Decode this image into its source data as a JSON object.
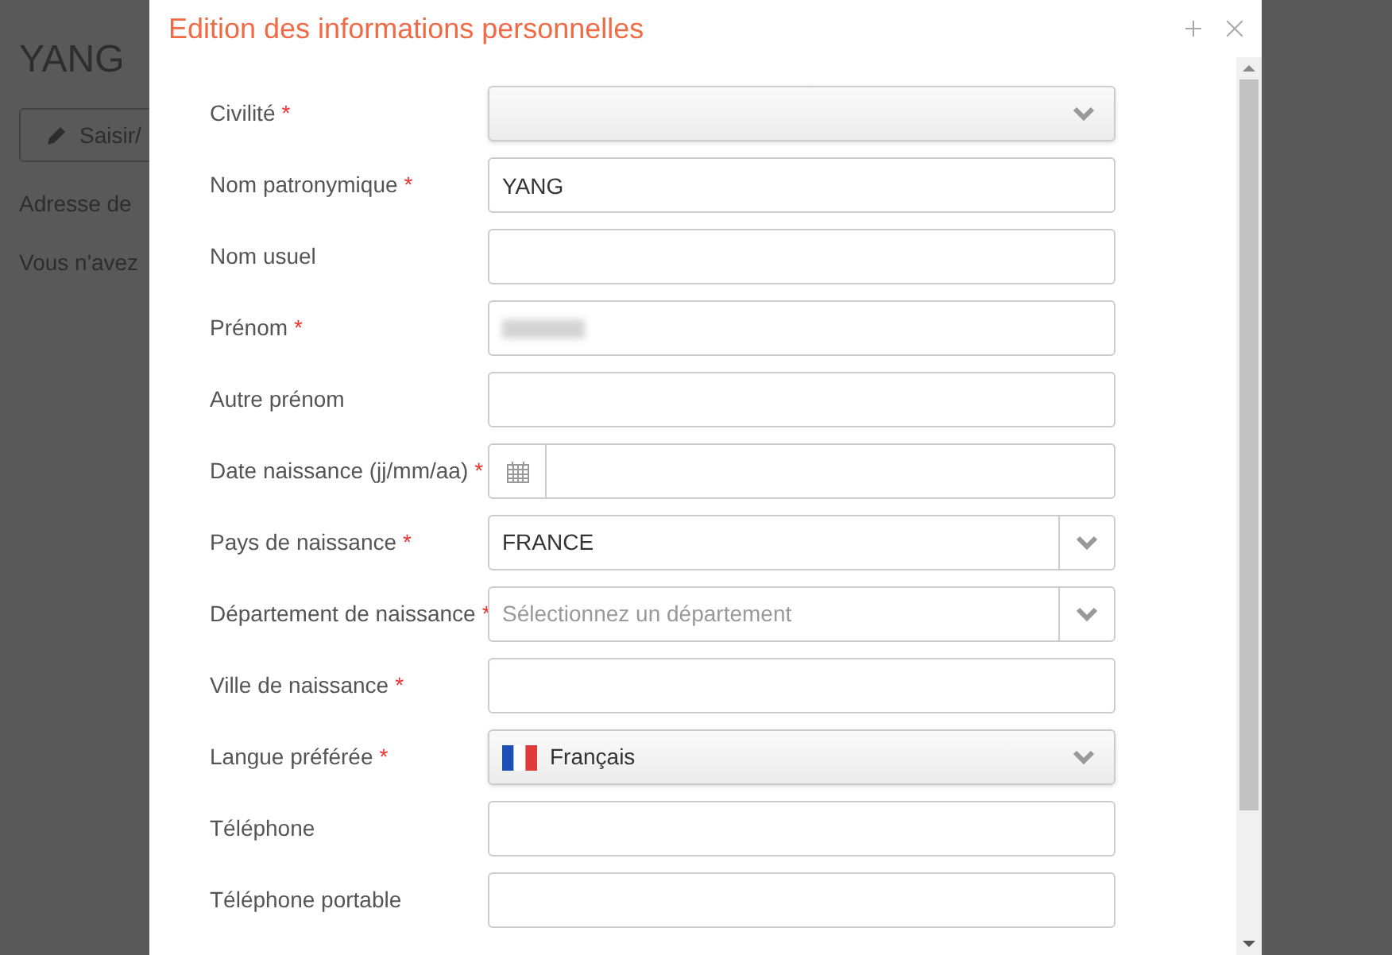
{
  "background_page": {
    "heading": "YANG",
    "button": "Saisir/",
    "lines": [
      "Adresse de",
      "Vous n'avez"
    ]
  },
  "dialog": {
    "title": "Edition des informations personnelles"
  },
  "fields": [
    {
      "label": "Civilité",
      "required_mark": "*",
      "kind": "select"
    },
    {
      "label": "Nom patronymique",
      "required_mark": "*",
      "kind": "text",
      "value": "YANG"
    },
    {
      "label": "Nom usuel",
      "kind": "text"
    },
    {
      "label": "Prénom",
      "required_mark": "*",
      "kind": "redacted"
    },
    {
      "label": "Autre prénom",
      "kind": "text"
    },
    {
      "label": "Date naissance (jj/mm/aa)",
      "required_mark": "*",
      "kind": "date"
    },
    {
      "label": "Pays de naissance",
      "required_mark": "*",
      "kind": "combo",
      "value": "FRANCE"
    },
    {
      "label": "Département de naissance",
      "required_mark": "*",
      "kind": "combo",
      "placeholder": "Sélectionnez un département"
    },
    {
      "label": "Ville de naissance",
      "required_mark": "*",
      "kind": "text"
    },
    {
      "label": "Langue préférée",
      "required_mark": "*",
      "kind": "flag-select",
      "value": "Français"
    },
    {
      "label": "Téléphone",
      "kind": "text"
    },
    {
      "label": "Téléphone portable",
      "kind": "text"
    }
  ]
}
